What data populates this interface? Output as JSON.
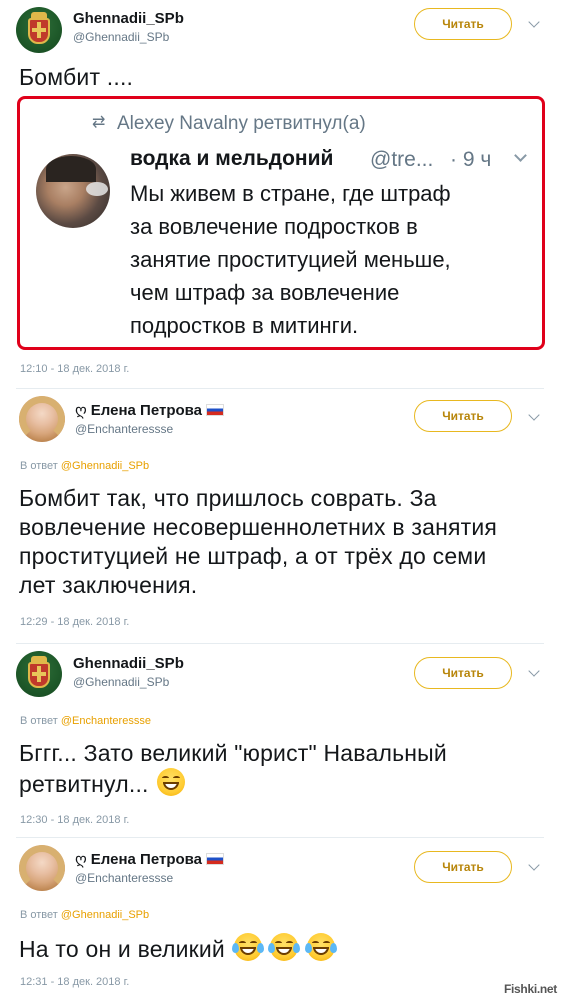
{
  "tweets": [
    {
      "author_name": "Ghennadii_SPb",
      "author_handle": "@Ghennadii_SPb",
      "follow_label": "Читать",
      "text": "Бомбит ....",
      "time": "12:10 - 18 дек. 2018 г.",
      "embedded": {
        "retweet_label": "Alexey Navalny ретвитнул(а)",
        "author_name": "водка и мельдоний",
        "author_handle": "@tre...",
        "relative_time": "· 9 ч",
        "lines": [
          "Мы живем в стране, где штраф",
          "за вовлечение подростков в",
          "занятие проституцией меньше,",
          "чем штраф за вовлечение",
          "подростков в митинги."
        ]
      }
    },
    {
      "author_name": "Елена Петрова",
      "author_prefix": "ღ",
      "author_handle": "@Enchanteressse",
      "follow_label": "Читать",
      "reply_prefix": "В ответ",
      "reply_to": "@Ghennadii_SPb",
      "lines": [
        "Бомбит так, что пришлось соврать. За",
        "вовлечение несовершеннолетних в занятия",
        "проституцией не штраф, а от трёх до семи",
        "лет заключения."
      ],
      "time": "12:29 - 18 дек. 2018 г."
    },
    {
      "author_name": "Ghennadii_SPb",
      "author_handle": "@Ghennadii_SPb",
      "follow_label": "Читать",
      "reply_prefix": "В ответ",
      "reply_to": "@Enchanteressse",
      "lines": [
        "Бггг... Зато великий \"юрист\" Навальный",
        "ретвитнул..."
      ],
      "emoji": "grinning-face",
      "time": "12:30 - 18 дек. 2018 г."
    },
    {
      "author_name": "Елена Петрова",
      "author_prefix": "ღ",
      "author_handle": "@Enchanteressse",
      "follow_label": "Читать",
      "reply_prefix": "В ответ",
      "reply_to": "@Ghennadii_SPb",
      "text": "На то он и великий",
      "emoji": "face-with-tears-of-joy",
      "time": "12:31 - 18 дек. 2018 г."
    }
  ],
  "watermark": "Fishki.net",
  "colors": {
    "follow_border": "#e8b820",
    "follow_text": "#b8860b",
    "mention": "#e8a000",
    "embed_border": "#e0001a"
  }
}
